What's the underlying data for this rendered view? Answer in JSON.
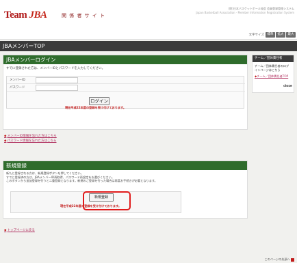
{
  "header": {
    "logo_team": "Team",
    "logo_jba": "JBA",
    "site_name": "関 係 者 サ イ ト",
    "org_name_ja": "(財)日本バスケットボール協会 会員登録管理システム",
    "org_name_en": "Japan Basketball Association - Member Information Registration System"
  },
  "subbar": {
    "fontsize_label": "文字サイズ",
    "sizes": [
      "標準",
      "拡大",
      "最大"
    ]
  },
  "page": {
    "title": "JBAメンバーTOP"
  },
  "login": {
    "heading": "JBAメンバーログイン",
    "instruction": "すでに登録された方は、メンバーIDとパスワードを入力してください。",
    "id_label": "メンバーID",
    "password_label": "パスワード",
    "id_value": "",
    "password_value": "",
    "button_label": "ログイン",
    "notice": "現在平成22年度の登録を受け付けております。",
    "links": [
      "メンバーID情報を忘れた方はこちら",
      "パスワード情報を忘れた方はこちら"
    ]
  },
  "sidebar": {
    "heading": "チーム／団体責任者",
    "text": "チーム／団体責任者のログインページはこちら",
    "link": "チーム／団体責任者TOP",
    "close": "close"
  },
  "register": {
    "heading": "新規登録",
    "description_lines": [
      "新たに登録される方は、新規登録ボタンを押してください。",
      "すでに登録済の方は、JBAメンバーID再取得、パスワード再設定をお選びください。",
      "このボタンから追加登録を行うと二重登録となります。新規のご登録を行った場合は再度お手続きが必要となります。"
    ],
    "button_label": "新規登録",
    "notice": "現在平成22年度の登録を受け付けております。"
  },
  "top_link": "トップページに戻る",
  "footer": {
    "page_top": "このページの先頭へ"
  },
  "colors": {
    "brand_red": "#b01818",
    "section_green": "#2f6c2c",
    "title_dark": "#3b3b3b",
    "highlight_red": "#e01a1a",
    "link_color": "#b0305f"
  }
}
